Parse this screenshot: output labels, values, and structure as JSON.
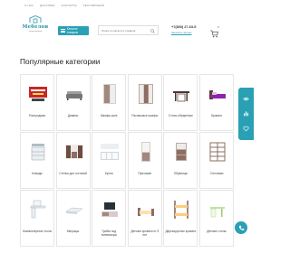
{
  "nav": {
    "items": [
      "О нас",
      "Доставка",
      "Контакты",
      "Реставрация"
    ]
  },
  "logo": {
    "name": "Мебелон",
    "tagline": "салон мебели"
  },
  "header": {
    "catalog_label": "Каталог товаров",
    "search_placeholder": "Поиск по каталогу товаров",
    "phone": "+7(800) 27-63-5",
    "callback_label": "Заказать звонок",
    "cart_count": "0"
  },
  "section": {
    "title": "Популярные категории"
  },
  "categories": [
    {
      "label": "Распродажа",
      "icon": "sale-banner-icon"
    },
    {
      "label": "Диваны",
      "icon": "sofa-icon"
    },
    {
      "label": "Шкафы-купе",
      "icon": "wardrobe-icon"
    },
    {
      "label": "Распашные шкафы",
      "icon": "wardrobe-hinged-icon"
    },
    {
      "label": "Столы обеденные",
      "icon": "dining-table-icon"
    },
    {
      "label": "Кровати",
      "icon": "bed-icon"
    },
    {
      "label": "Комоды",
      "icon": "dresser-icon"
    },
    {
      "label": "Стенки для гостиной",
      "icon": "living-wall-icon"
    },
    {
      "label": "Кухни",
      "icon": "kitchen-icon"
    },
    {
      "label": "Прихожие",
      "icon": "hallway-icon"
    },
    {
      "label": "Обувницы",
      "icon": "shoe-cabinet-icon"
    },
    {
      "label": "Стеллажи",
      "icon": "shelving-icon"
    },
    {
      "label": "Компьютерные столы",
      "icon": "computer-desk-icon"
    },
    {
      "label": "Матрацы",
      "icon": "mattress-icon"
    },
    {
      "label": "Тумбы под телевизоры",
      "icon": "tv-stand-icon"
    },
    {
      "label": "Детские кровати от 5 лет",
      "icon": "kids-bed-icon"
    },
    {
      "label": "Двухъярусные кровати",
      "icon": "bunk-bed-icon"
    },
    {
      "label": "Детские столы",
      "icon": "kids-desk-icon"
    }
  ],
  "colors": {
    "accent": "#2aa0b4",
    "text": "#333333",
    "border": "#e6e6e6"
  }
}
